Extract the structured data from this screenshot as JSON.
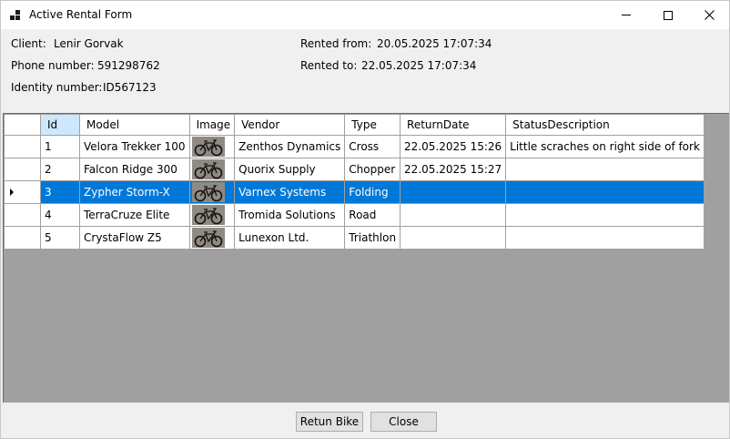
{
  "window": {
    "title": "Active Rental Form"
  },
  "info": {
    "client_label": "Client:",
    "client_value": "Lenir Gorvak",
    "phone_label": "Phone number:",
    "phone_value": "591298762",
    "identity_label": "Identity number:",
    "identity_value": "ID567123",
    "rented_from_label": "Rented from:",
    "rented_from_value": "20.05.2025 17:07:34",
    "rented_to_label": "Rented to:",
    "rented_to_value": "22.05.2025 17:07:34"
  },
  "grid": {
    "columns": [
      "Id",
      "Model",
      "Image",
      "Vendor",
      "Type",
      "ReturnDate",
      "StatusDescription"
    ],
    "rows": [
      {
        "id": "1",
        "model": "Velora Trekker 100",
        "image": "bike-image",
        "vendor": "Zenthos Dynamics",
        "type": "Cross",
        "return_date": "22.05.2025 15:26",
        "status": "Little scraches on right side of fork"
      },
      {
        "id": "2",
        "model": "Falcon Ridge 300",
        "image": "bike-image",
        "vendor": "Quorix Supply",
        "type": "Chopper",
        "return_date": "22.05.2025 15:27",
        "status": ""
      },
      {
        "id": "3",
        "model": "Zypher Storm-X",
        "image": "bike-image",
        "vendor": "Varnex Systems",
        "type": "Folding",
        "return_date": "",
        "status": ""
      },
      {
        "id": "4",
        "model": "TerraCruze Elite",
        "image": "bike-image",
        "vendor": "Tromida Solutions",
        "type": "Road",
        "return_date": "",
        "status": ""
      },
      {
        "id": "5",
        "model": "CrystaFlow Z5",
        "image": "bike-image",
        "vendor": "Lunexon Ltd.",
        "type": "Triathlon",
        "return_date": "",
        "status": ""
      }
    ],
    "selected_row": 3,
    "selection_color": "#0078d7"
  },
  "buttons": {
    "return_label": "Retun Bike",
    "close_label": "Close"
  }
}
